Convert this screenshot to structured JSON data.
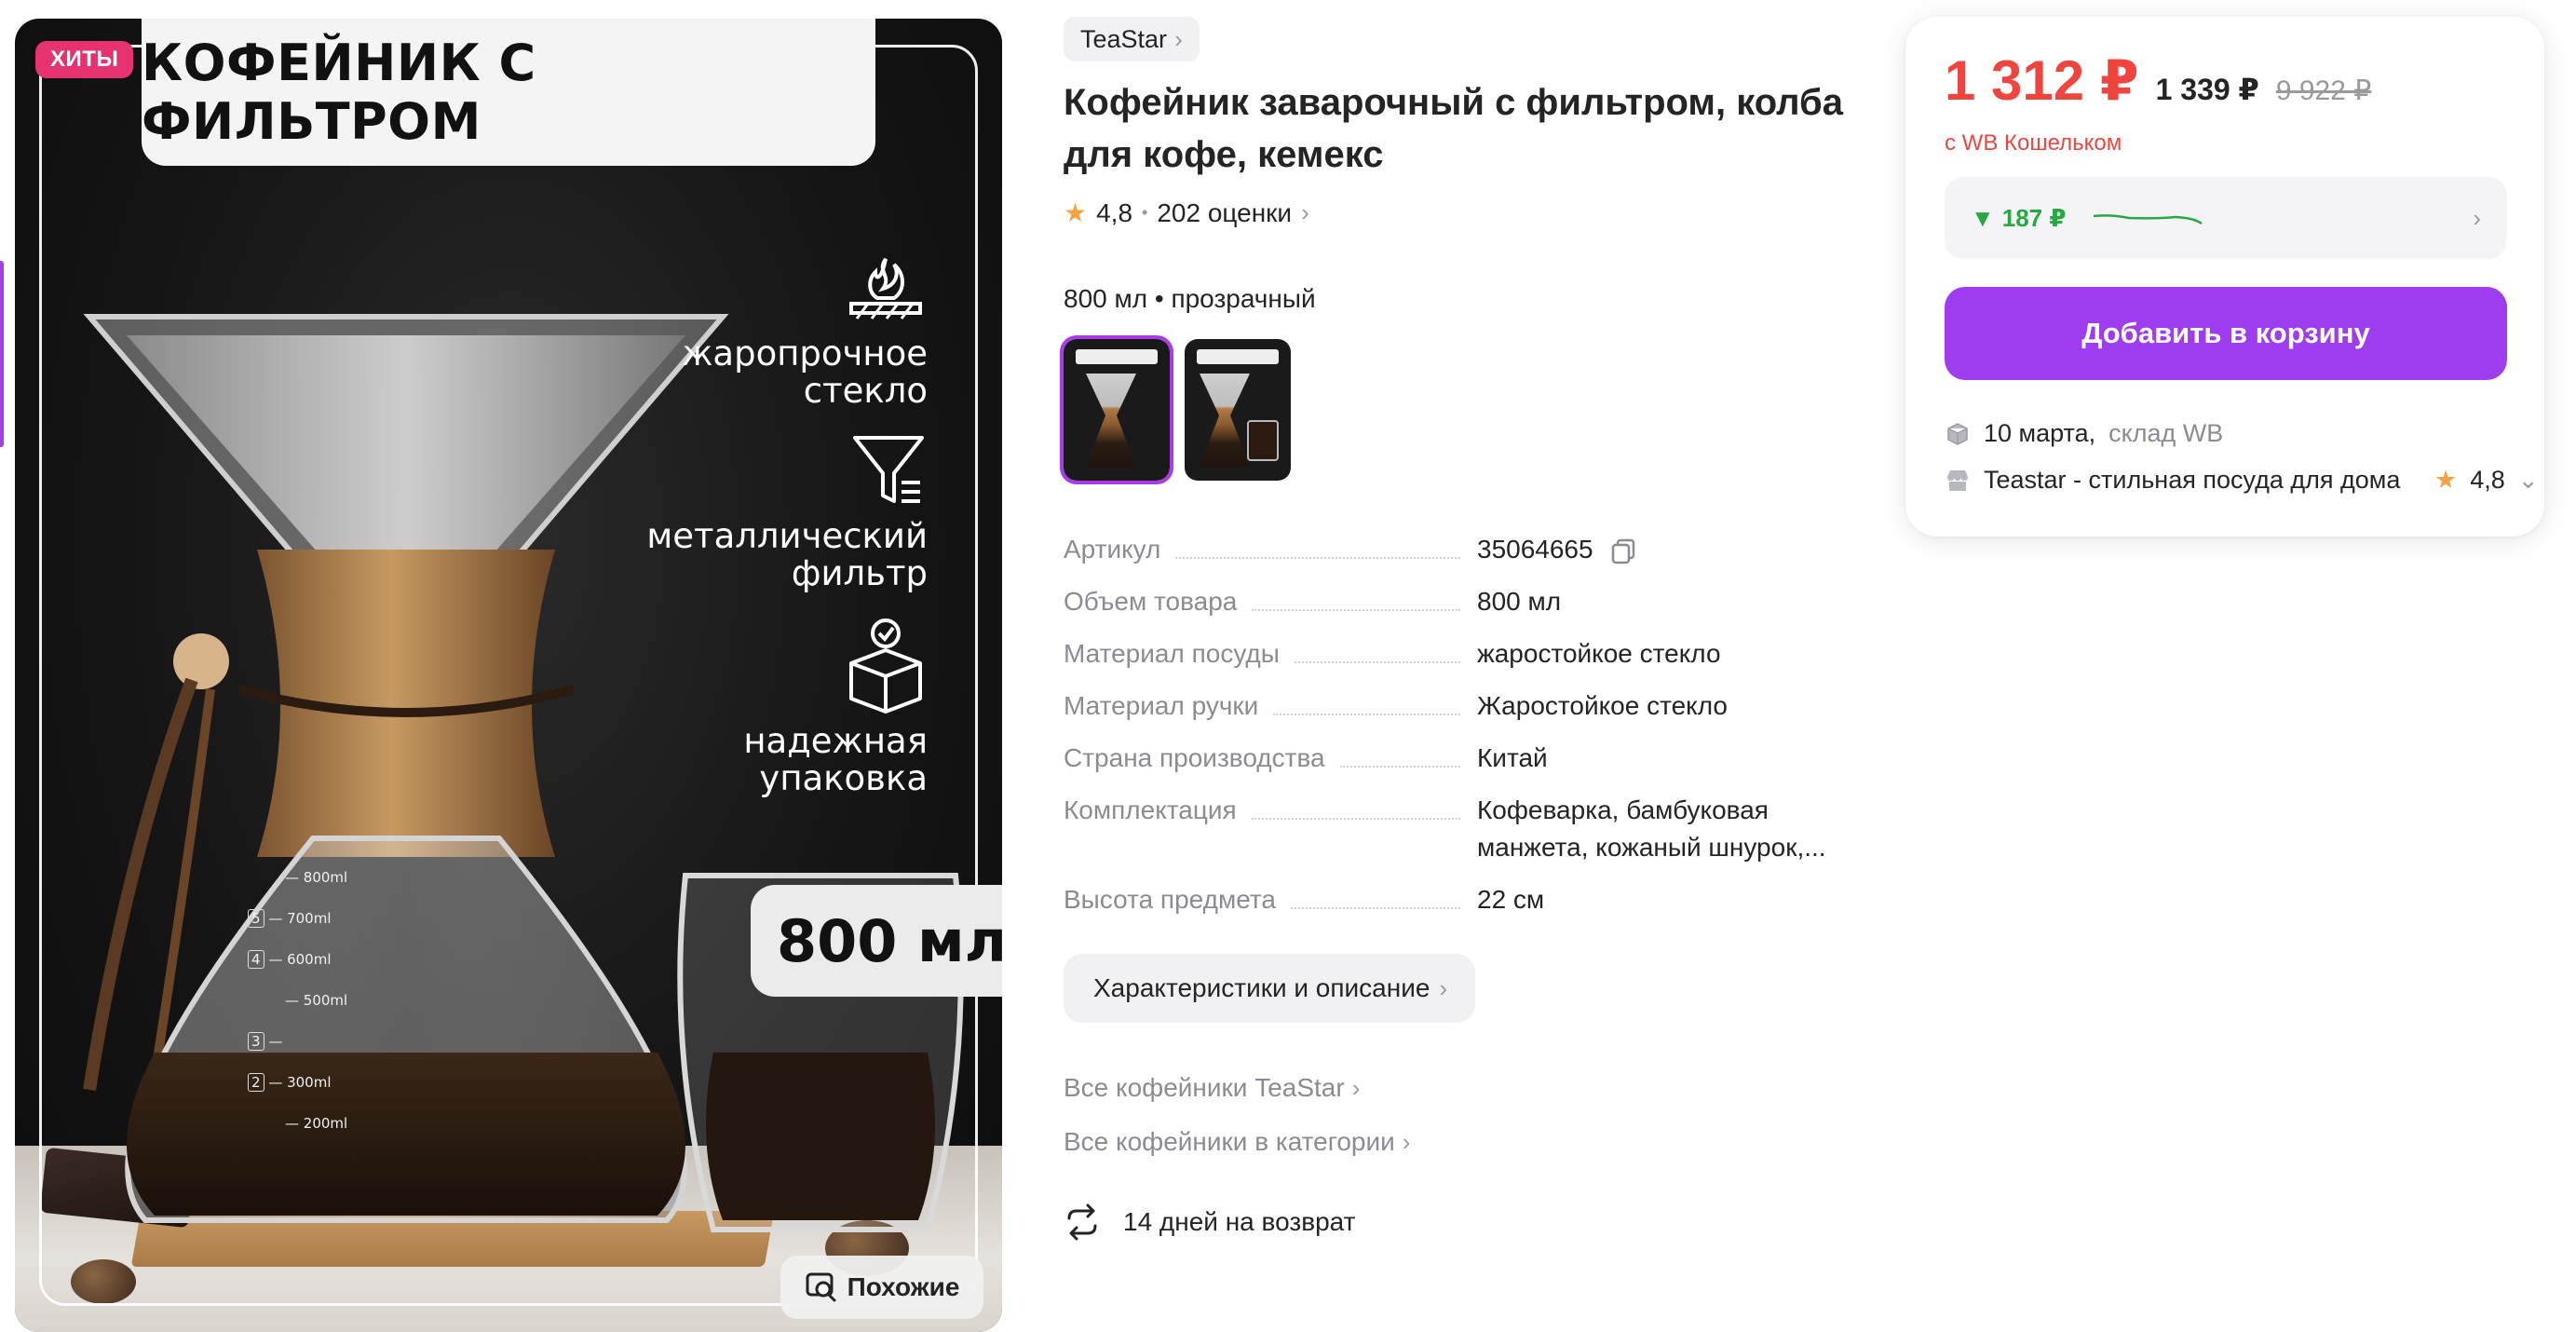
{
  "image": {
    "badge": "ХИТЫ",
    "headline": "КОФЕЙНИК С ФИЛЬТРОМ",
    "features": [
      {
        "icon": "fire-resistant-icon",
        "text_1": "жаропрочное",
        "text_2": "стекло"
      },
      {
        "icon": "funnel-filter-icon",
        "text_1": "металлический",
        "text_2": "фильтр"
      },
      {
        "icon": "package-check-icon",
        "text_1": "надежная",
        "text_2": "упаковка"
      }
    ],
    "volume_label": "800 мл",
    "scale_marks": [
      "800ml",
      "700ml",
      "600ml",
      "500ml",
      "300ml",
      "200ml"
    ],
    "scale_digits": [
      "5",
      "4",
      "3",
      "2"
    ],
    "similar_button": "Похожие",
    "similar_icon": "image-search-icon"
  },
  "product": {
    "brand": "TeaStar",
    "title": "Кофейник заварочный с фильтром, колба для кофе, кемекс",
    "rating": "4,8",
    "reviews": "202 оценки",
    "variant": "800 мл • прозрачный",
    "thumbnails": [
      "thumb-1",
      "thumb-2"
    ],
    "specs": [
      {
        "label": "Артикул",
        "value": "35064665"
      },
      {
        "label": "Объем товара",
        "value": "800 мл"
      },
      {
        "label": "Материал посуды",
        "value": "жаростойкое стекло"
      },
      {
        "label": "Материал ручки",
        "value": "Жаростойкое стекло"
      },
      {
        "label": "Страна производства",
        "value": "Китай"
      },
      {
        "label": "Комплектация",
        "value": "Кофеварка, бамбуковая манжета, кожаный шнурок,..."
      },
      {
        "label": "Высота предмета",
        "value": "22 см"
      }
    ],
    "characteristics_button": "Характеристики и описание",
    "links": [
      "Все кофейники TeaStar",
      "Все кофейники в категории"
    ],
    "return_policy": "14 дней на возврат"
  },
  "buy": {
    "price": "1 312 ₽",
    "price_regular": "1 339 ₽",
    "price_old": "9 922 ₽",
    "wallet_note": "с WB Кошельком",
    "price_drop": "187 ₽",
    "add_to_cart": "Добавить в корзину",
    "delivery_date": "10 марта,",
    "warehouse": "склад WB",
    "seller": "Teastar - стильная посуда для дома",
    "seller_rating": "4,8"
  },
  "colors": {
    "accent": "#a03cf0",
    "price": "#f0443f",
    "badge": "#e6336f",
    "drop": "#28a745"
  }
}
